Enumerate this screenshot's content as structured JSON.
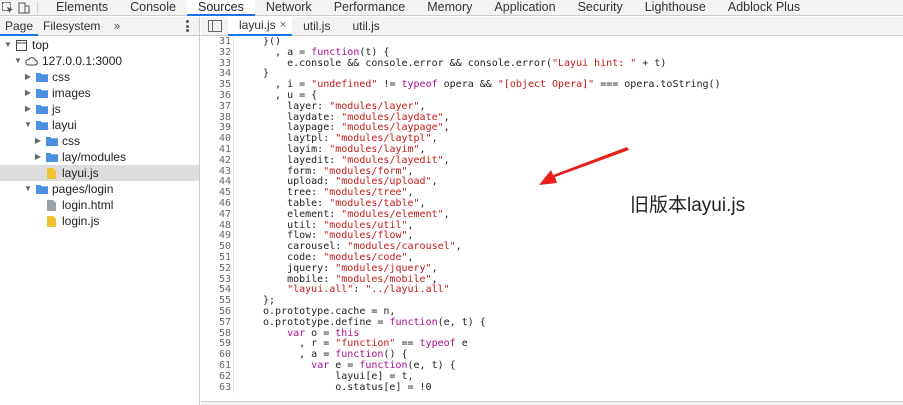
{
  "toolbar": {
    "tabs": [
      "Elements",
      "Console",
      "Sources",
      "Network",
      "Performance",
      "Memory",
      "Application",
      "Security",
      "Lighthouse",
      "Adblock Plus"
    ],
    "active_tab": "Sources"
  },
  "navigator": {
    "tabs": [
      "Page",
      "Filesystem"
    ],
    "more": "»",
    "tree": [
      {
        "label": "top",
        "depth": 0,
        "expanded": true,
        "icon": "frame-icon"
      },
      {
        "label": "127.0.0.1:3000",
        "depth": 1,
        "expanded": true,
        "icon": "cloud-icon"
      },
      {
        "label": "css",
        "depth": 2,
        "expanded": false,
        "icon": "folder-icon"
      },
      {
        "label": "images",
        "depth": 2,
        "expanded": false,
        "icon": "folder-icon"
      },
      {
        "label": "js",
        "depth": 2,
        "expanded": false,
        "icon": "folder-icon"
      },
      {
        "label": "layui",
        "depth": 2,
        "expanded": true,
        "icon": "folder-icon"
      },
      {
        "label": "css",
        "depth": 3,
        "expanded": false,
        "icon": "folder-icon"
      },
      {
        "label": "lay/modules",
        "depth": 3,
        "expanded": false,
        "icon": "folder-icon"
      },
      {
        "label": "layui.js",
        "depth": 3,
        "file": true,
        "selected": true,
        "icon": "js-file-icon"
      },
      {
        "label": "pages/login",
        "depth": 2,
        "expanded": true,
        "icon": "folder-icon"
      },
      {
        "label": "login.html",
        "depth": 3,
        "file": true,
        "icon": "html-file-icon"
      },
      {
        "label": "login.js",
        "depth": 3,
        "file": true,
        "icon": "js-file-icon"
      }
    ]
  },
  "editor": {
    "file_tabs": [
      {
        "label": "layui.js",
        "active": true,
        "close": "×"
      },
      {
        "label": "util.js",
        "active": false
      },
      {
        "label": "util.js",
        "active": false
      }
    ],
    "lines": [
      {
        "n": 31,
        "html": "    }()"
      },
      {
        "n": 32,
        "html": "      , a = <span class='kw'>function</span>(t) {"
      },
      {
        "n": 33,
        "html": "        e.console && console.error && console.error(<span class='str'>\"Layui hint: \"</span> + t)"
      },
      {
        "n": 34,
        "html": "    }"
      },
      {
        "n": 35,
        "html": "      , i = <span class='str'>\"undefined\"</span> != <span class='kw'>typeof</span> opera && <span class='str'>\"[object Opera]\"</span> === opera.toString()"
      },
      {
        "n": 36,
        "html": "      , u = {"
      },
      {
        "n": 37,
        "html": "        layer: <span class='str'>\"modules/layer\"</span>,"
      },
      {
        "n": 38,
        "html": "        laydate: <span class='str'>\"modules/laydate\"</span>,"
      },
      {
        "n": 39,
        "html": "        laypage: <span class='str'>\"modules/laypage\"</span>,"
      },
      {
        "n": 40,
        "html": "        laytpl: <span class='str'>\"modules/laytpl\"</span>,"
      },
      {
        "n": 41,
        "html": "        layim: <span class='str'>\"modules/layim\"</span>,"
      },
      {
        "n": 42,
        "html": "        layedit: <span class='str'>\"modules/layedit\"</span>,"
      },
      {
        "n": 43,
        "html": "        form: <span class='str'>\"modules/form\"</span>,"
      },
      {
        "n": 44,
        "html": "        upload: <span class='str'>\"modules/upload\"</span>,"
      },
      {
        "n": 45,
        "html": "        tree: <span class='str'>\"modules/tree\"</span>,"
      },
      {
        "n": 46,
        "html": "        table: <span class='str'>\"modules/table\"</span>,"
      },
      {
        "n": 47,
        "html": "        element: <span class='str'>\"modules/element\"</span>,"
      },
      {
        "n": 48,
        "html": "        util: <span class='str'>\"modules/util\"</span>,"
      },
      {
        "n": 49,
        "html": "        flow: <span class='str'>\"modules/flow\"</span>,"
      },
      {
        "n": 50,
        "html": "        carousel: <span class='str'>\"modules/carousel\"</span>,"
      },
      {
        "n": 51,
        "html": "        code: <span class='str'>\"modules/code\"</span>,"
      },
      {
        "n": 52,
        "html": "        jquery: <span class='str'>\"modules/jquery\"</span>,"
      },
      {
        "n": 53,
        "html": "        mobile: <span class='str'>\"modules/mobile\"</span>,"
      },
      {
        "n": 54,
        "html": "        <span class='str'>\"layui.all\"</span>: <span class='str'>\"../layui.all\"</span>"
      },
      {
        "n": 55,
        "html": "    };"
      },
      {
        "n": 56,
        "html": "    o.prototype.cache = n,"
      },
      {
        "n": 57,
        "html": "    o.prototype.define = <span class='kw'>function</span>(e, t) {"
      },
      {
        "n": 58,
        "html": "        <span class='kw'>var</span> o = <span class='kw'>this</span>"
      },
      {
        "n": 59,
        "html": "          , r = <span class='str'>\"function\"</span> == <span class='kw'>typeof</span> e"
      },
      {
        "n": 60,
        "html": "          , a = <span class='kw'>function</span>() {"
      },
      {
        "n": 61,
        "html": "            <span class='kw'>var</span> e = <span class='kw'>function</span>(e, t) {"
      },
      {
        "n": 62,
        "html": "                layui[e] = t,"
      },
      {
        "n": 63,
        "html": "                o.status[e] = !0"
      }
    ]
  },
  "annotation": {
    "text": "旧版本layui.js",
    "arrow_color": "#e8201a"
  }
}
